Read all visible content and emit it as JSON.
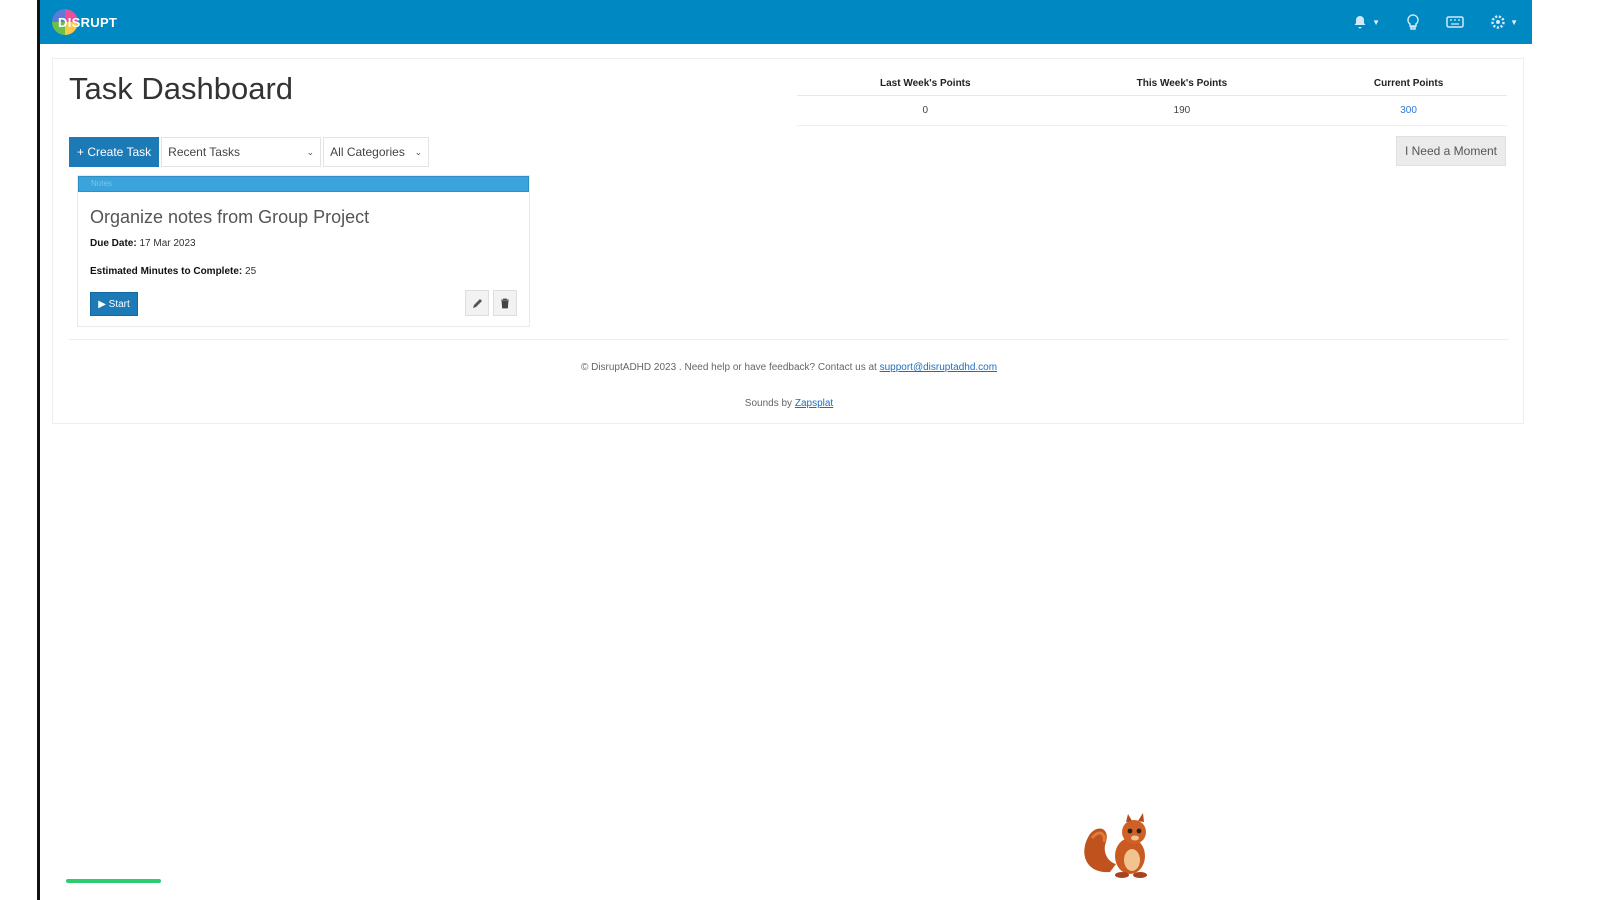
{
  "header": {
    "logo_text": "DISRUPT",
    "icons": [
      "bell-icon",
      "lightbulb-icon",
      "keyboard-icon",
      "gear-icon"
    ]
  },
  "page": {
    "title": "Task Dashboard"
  },
  "points": {
    "headers": [
      "Last Week's Points",
      "This Week's Points",
      "Current Points"
    ],
    "values": [
      "0",
      "190",
      "300"
    ]
  },
  "toolbar": {
    "create_label": "+ Create Task",
    "recent_selected": "Recent Tasks",
    "category_selected": "All Categories",
    "need_moment_label": "I Need a Moment"
  },
  "task": {
    "category": "Notes",
    "title": "Organize notes from Group Project",
    "due_label": "Due Date:",
    "due_value": "17 Mar 2023",
    "est_label": "Estimated Minutes to Complete:",
    "est_value": "25",
    "start_label": "▶ Start"
  },
  "footer": {
    "line1_text": "© DisruptADHD 2023 . Need help or have feedback? Contact us at ",
    "line1_link": "support@disruptadhd.com",
    "line2_text": "Sounds by ",
    "line2_link": "Zapsplat"
  },
  "colors": {
    "brand": "#0088c2",
    "button": "#1c7ab6",
    "card_header": "#3aa3dc"
  }
}
